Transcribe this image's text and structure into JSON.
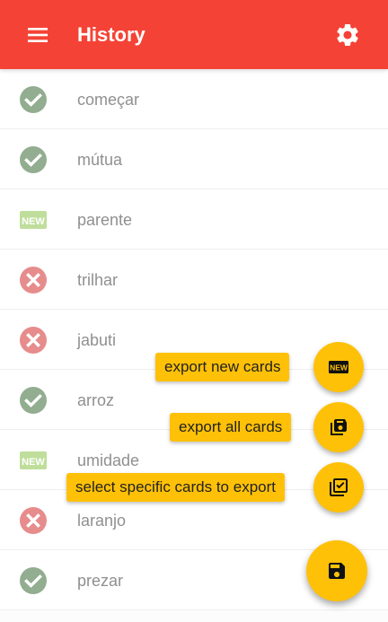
{
  "app_bar": {
    "title": "History",
    "menu_icon": "menu-icon",
    "settings_icon": "gear-icon",
    "color": "#f44336"
  },
  "history": {
    "items": [
      {
        "word": "começar",
        "status": "correct"
      },
      {
        "word": "mútua",
        "status": "correct"
      },
      {
        "word": "parente",
        "status": "new"
      },
      {
        "word": "trilhar",
        "status": "wrong"
      },
      {
        "word": "jabuti",
        "status": "wrong"
      },
      {
        "word": "arroz",
        "status": "correct"
      },
      {
        "word": "umidade",
        "status": "new"
      },
      {
        "word": "laranjo",
        "status": "wrong"
      },
      {
        "word": "prezar",
        "status": "correct"
      }
    ],
    "status_colors": {
      "correct": "#3a6b35",
      "wrong": "#d32f2f",
      "new": "#8bc34a"
    }
  },
  "export_menu": {
    "accent": "#ffc107",
    "actions": [
      {
        "label": "export new cards",
        "icon": "new-icon"
      },
      {
        "label": "export all cards",
        "icon": "save-multiple-icon"
      },
      {
        "label": "select specific cards to export",
        "icon": "select-multiple-icon"
      }
    ],
    "main_icon": "save-icon"
  }
}
